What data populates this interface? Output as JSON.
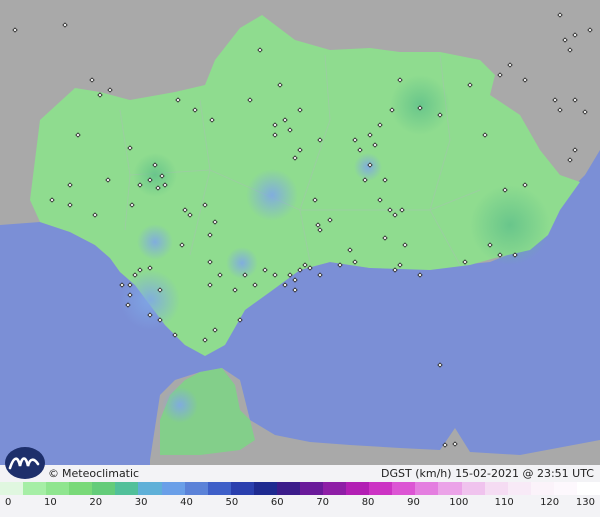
{
  "brand": {
    "copyright": "©",
    "name": "Meteoclimatic",
    "logo_icon": "meteoclimatic-wave-logo"
  },
  "stamp": {
    "variable": "DGST (km/h)",
    "datetime": "15-02-2021 @ 23:51 UTC"
  },
  "legend": {
    "ticks": [
      "0",
      "10",
      "20",
      "30",
      "40",
      "50",
      "60",
      "70",
      "80",
      "90",
      "100",
      "110",
      "120",
      "130"
    ],
    "colors": [
      "#e0f7e0",
      "#a6eea6",
      "#8fe58f",
      "#79d979",
      "#64cc7a",
      "#52c09a",
      "#5fb0d8",
      "#6a9fe8",
      "#5b82d8",
      "#3e5fc8",
      "#2a3fae",
      "#1e2a90",
      "#3b1c8a",
      "#6a1a9a",
      "#8e1ea6",
      "#b21fb4",
      "#cc33c4",
      "#dc55d4",
      "#e47ee0",
      "#eba3e8",
      "#f0c3ee",
      "#f5dcf3",
      "#f8eaf7",
      "#fbf3fa",
      "#fdf8fd",
      "#ffffff"
    ]
  },
  "colors": {
    "sea": "#7b8fd6",
    "land_other": "#a9a9a9",
    "region": "#8fdc8f"
  }
}
